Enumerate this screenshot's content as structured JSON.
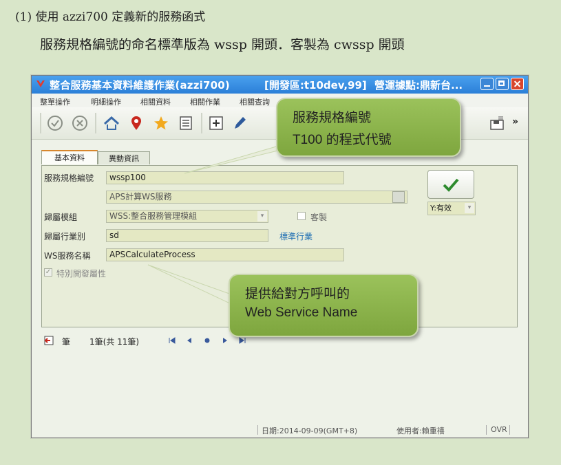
{
  "doc": {
    "line1": "(1) 使用 azzi700 定義新的服務函式",
    "line2": "服務規格編號的命名標準版為  wssp  開頭．客製為  cwssp  開頭"
  },
  "window": {
    "title": "整合服務基本資料維護作業(azzi700)",
    "env": "[開發區:t10dev,99]",
    "site": "營運據點:鼎新台...",
    "title_color": "#2b7fd8"
  },
  "menu": [
    "整單操作",
    "明細操作",
    "相關資料",
    "相關作業",
    "相關查詢"
  ],
  "toolbar": {
    "icons": [
      "check-circle-icon",
      "cancel-circle-icon",
      "home-icon",
      "location-pin-icon",
      "star-icon",
      "list-icon",
      "add-box-icon",
      "pencil-icon",
      "save-icon"
    ],
    "more": "»"
  },
  "tabs": [
    "基本資料",
    "異動資訊"
  ],
  "form": {
    "spec_no_label": "服務規格編號",
    "spec_no_value": "wssp100",
    "spec_desc_value": "APS計算WS服務",
    "module_label": "歸屬模組",
    "module_value": "WSS:整合服務管理模組",
    "custom_label": "客製",
    "industry_label": "歸屬行業別",
    "industry_value": "sd",
    "industry_link": "標準行業",
    "ws_name_label": "WS服務名稱",
    "ws_name_value": "APSCalculateProcess",
    "special_dev_label": "特別開發屬性",
    "status_value": "Y:有效"
  },
  "navigator": {
    "record_label": "筆",
    "position": "1筆(共  11筆)"
  },
  "statusbar": {
    "date": "日期:2014-09-09(GMT+8)",
    "user": "使用者:賴重禧",
    "mode": "OVR"
  },
  "callouts": {
    "c1_line1": "服務規格編號",
    "c1_line2": "T100 的程式代號",
    "c2_line1": "提供給對方呼叫的",
    "c2_line2": "Web Service Name",
    "callout_color": "#8db24c"
  }
}
